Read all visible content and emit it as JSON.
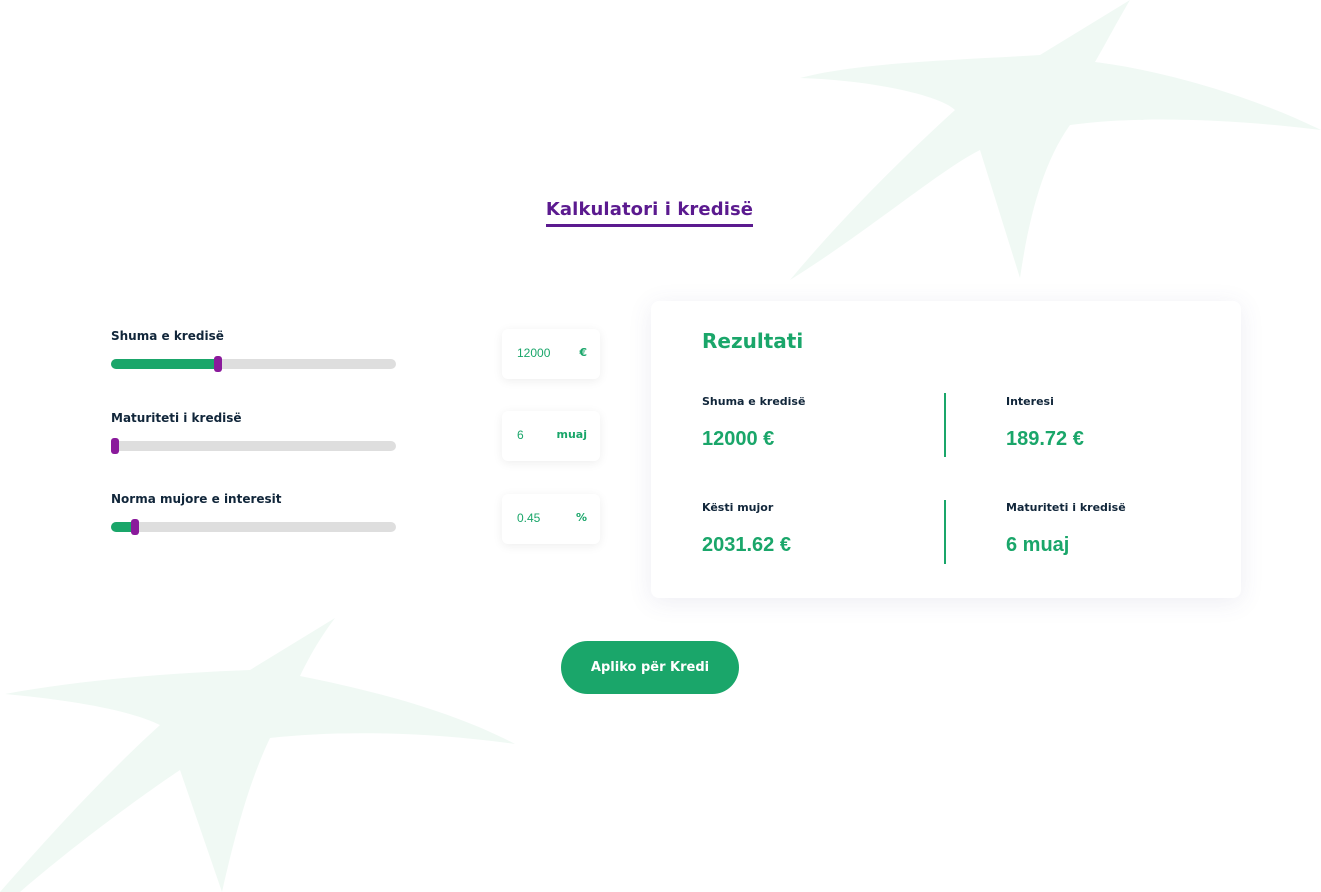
{
  "calculator": {
    "title": "Kalkulatori i kredisë"
  },
  "sliders": [
    {
      "label": "Shuma e kredisë",
      "value": "12000",
      "unit": "€",
      "fill_fraction": 0.375
    },
    {
      "label": "Maturiteti i kredisë",
      "value": "6",
      "unit": "muaj",
      "fill_fraction": 0.015
    },
    {
      "label": "Norma mujore e interesit",
      "value": "0.45",
      "unit": "%",
      "fill_fraction": 0.085
    }
  ],
  "results": {
    "title": "Rezultati",
    "items": [
      {
        "label": "Shuma e kredisë",
        "value": "12000 €"
      },
      {
        "label": "Interesi",
        "value": "189.72 €"
      },
      {
        "label": "Kësti mujor",
        "value": "2031.62 €"
      },
      {
        "label": "Maturiteti i kredisë",
        "value": "6 muaj"
      }
    ]
  },
  "actions": {
    "apply_label": "Apliko për Kredi"
  },
  "colors": {
    "primary_green": "#1aa66a",
    "purple": "#5b1a8f",
    "thumb_purple": "#8a1a9b",
    "track_gray": "#dedede",
    "decor_green": "#f0f9f4"
  }
}
